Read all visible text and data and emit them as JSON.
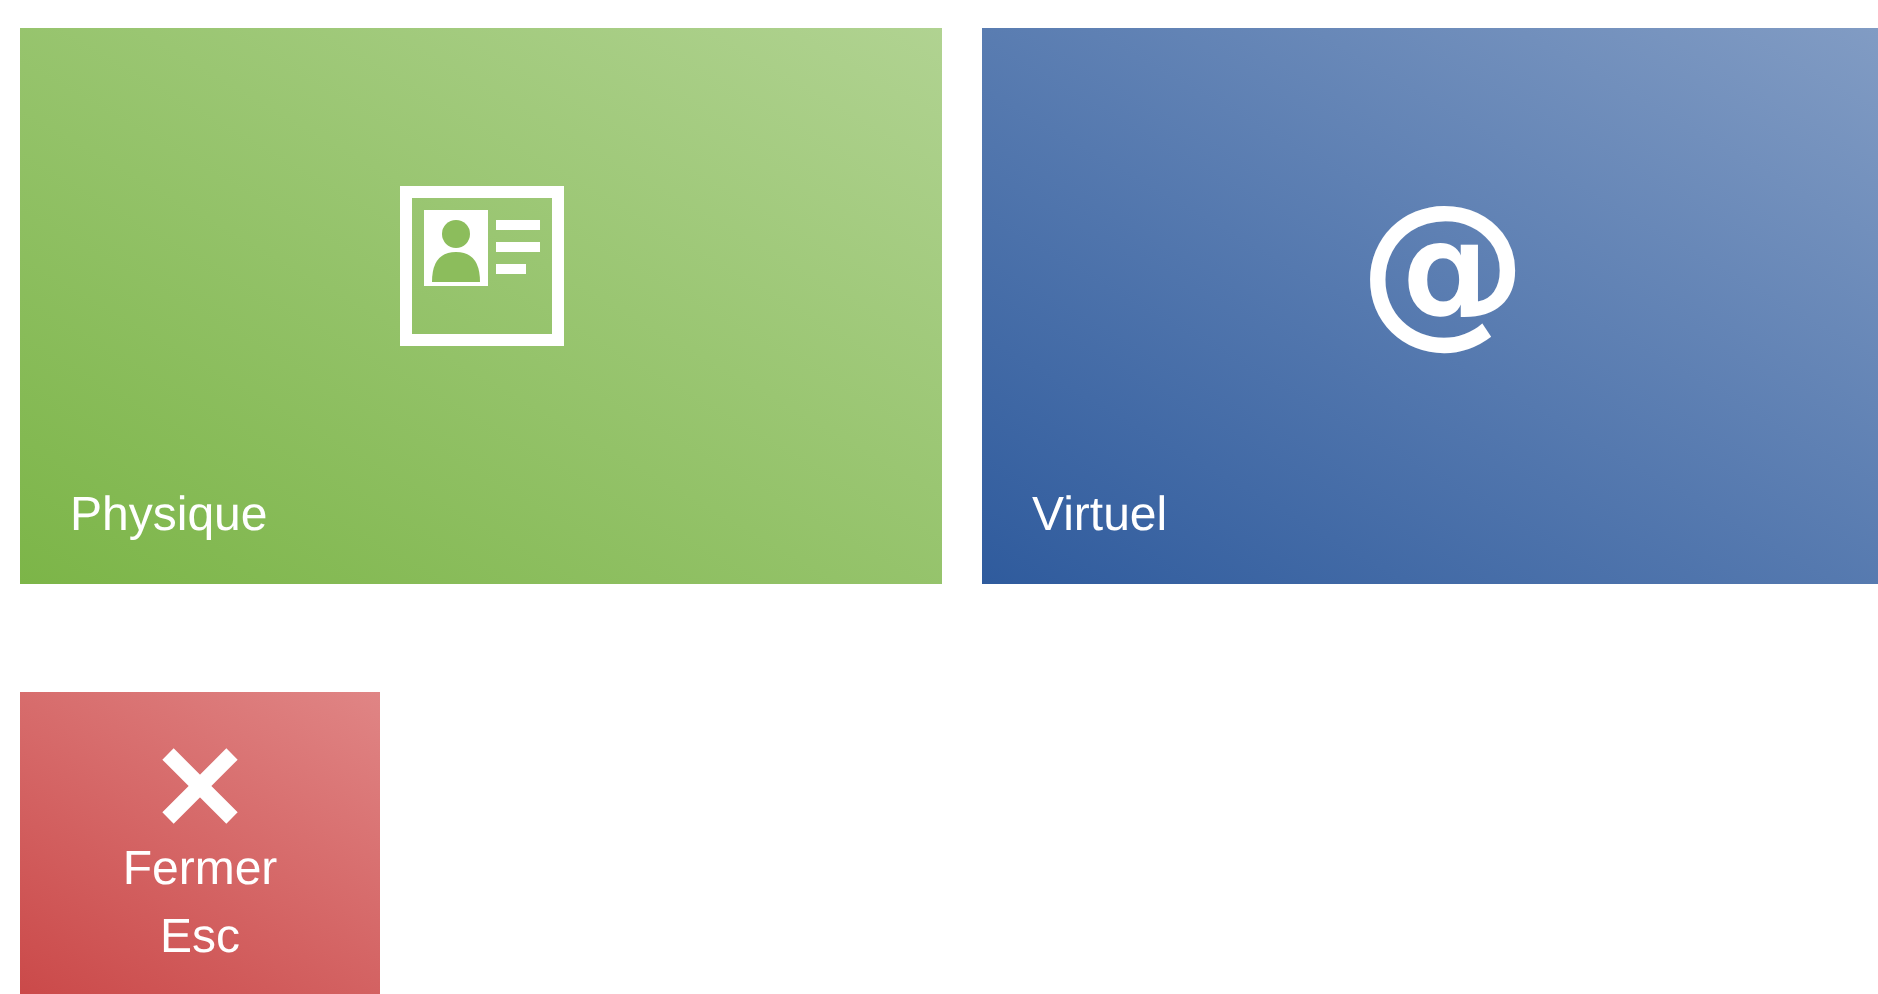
{
  "tiles": [
    {
      "kind": "card",
      "label": "Physique",
      "color": "#7cb548"
    },
    {
      "kind": "glyph",
      "glyph": "@",
      "label": "Virtuel",
      "color": "#2f5b9d"
    }
  ],
  "close_button": {
    "label": "Fermer",
    "shortcut": "Esc"
  }
}
